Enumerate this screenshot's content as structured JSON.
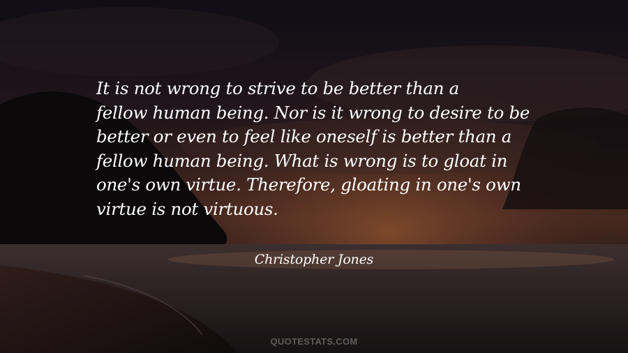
{
  "quote": {
    "lines": [
      "It is not wrong to strive to be better than a",
      "fellow human being. Nor is it wrong to desire to be",
      "better or even to feel like oneself is better than a",
      "fellow human being. What is wrong is to gloat in",
      "one's own virtue. Therefore, gloating in one's own",
      "virtue is not virtuous."
    ]
  },
  "author": "Christopher Jones",
  "watermark": "QUOTESTATS.COM",
  "colors": {
    "text": "#ffffff",
    "sky_top": "#1a1418",
    "sunset_glow": "#8a4a2e",
    "sea": "#2a2426"
  }
}
